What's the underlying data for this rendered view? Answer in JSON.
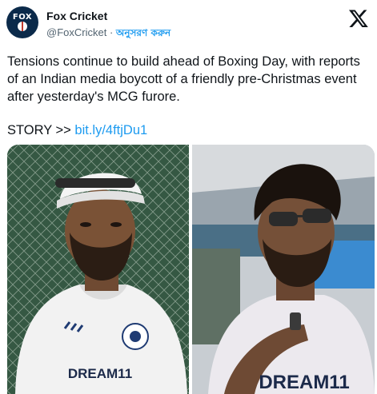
{
  "account": {
    "name": "Fox Cricket",
    "handle": "@FoxCricket",
    "separator": "·",
    "follow_label": "অনুসরণ করুন",
    "avatar_text": "FOX"
  },
  "tweet": {
    "text": "Tensions continue to build ahead of Boxing Day, with reports of an Indian media boycott of a friendly pre-Christmas event after yesterday's MCG furore.",
    "story_prefix": "STORY >> ",
    "story_link": "bit.ly/4ftjDu1"
  },
  "media": {
    "left_jersey_text": "DREAM11",
    "right_jersey_text": "DREAM11"
  },
  "icons": {
    "platform": "x-logo-icon"
  }
}
